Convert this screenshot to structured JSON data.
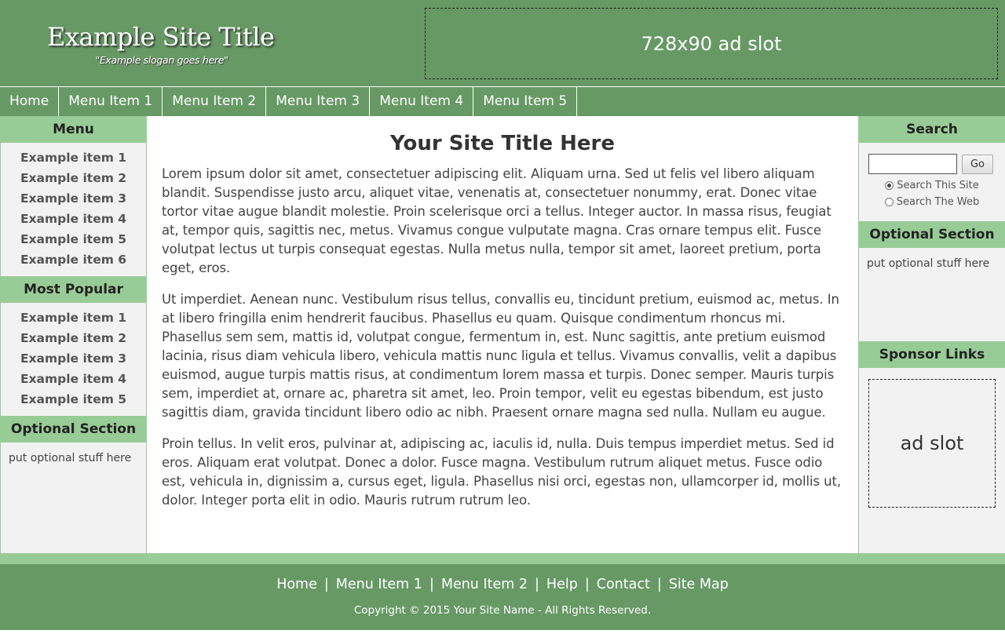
{
  "header": {
    "site_title": "Example Site Title",
    "slogan": "\"Example slogan goes here\"",
    "ad_top": "728x90 ad slot"
  },
  "nav": [
    "Home",
    "Menu Item 1",
    "Menu Item 2",
    "Menu Item 3",
    "Menu Item 4",
    "Menu Item 5"
  ],
  "left": {
    "menu_title": "Menu",
    "menu_items": [
      "Example item 1",
      "Example item 2",
      "Example item 3",
      "Example item 4",
      "Example item 5",
      "Example item 6"
    ],
    "popular_title": "Most Popular",
    "popular_items": [
      "Example item 1",
      "Example item 2",
      "Example item 3",
      "Example item 4",
      "Example item 5"
    ],
    "optional_title": "Optional Section",
    "optional_text": "put optional stuff here"
  },
  "main": {
    "title": "Your Site Title Here",
    "paragraphs": [
      "Lorem ipsum dolor sit amet, consectetuer adipiscing elit. Aliquam urna. Sed ut felis vel libero aliquam blandit. Suspendisse justo arcu, aliquet vitae, venenatis at, consectetuer nonummy, erat. Donec vitae tortor vitae augue blandit molestie. Proin scelerisque orci a tellus. Integer auctor. In massa risus, feugiat at, tempor quis, sagittis nec, metus. Vivamus congue vulputate magna. Cras ornare tempus elit. Fusce volutpat lectus ut turpis consequat egestas. Nulla metus nulla, tempor sit amet, laoreet pretium, porta eget, eros.",
      "Ut imperdiet. Aenean nunc. Vestibulum risus tellus, convallis eu, tincidunt pretium, euismod ac, metus. In at libero fringilla enim hendrerit faucibus. Phasellus eu quam. Quisque condimentum rhoncus mi. Phasellus sem sem, mattis id, volutpat congue, fermentum in, est. Nunc sagittis, ante pretium euismod lacinia, risus diam vehicula libero, vehicula mattis nunc ligula et tellus. Vivamus convallis, velit a dapibus euismod, augue turpis mattis risus, at condimentum lorem massa et turpis. Donec semper. Mauris turpis sem, imperdiet at, ornare ac, pharetra sit amet, leo. Proin tempor, velit eu egestas bibendum, est justo sagittis diam, gravida tincidunt libero odio ac nibh. Praesent ornare magna sed nulla. Nullam eu augue.",
      "Proin tellus. In velit eros, pulvinar at, adipiscing ac, iaculis id, nulla. Duis tempus imperdiet metus. Sed id eros. Aliquam erat volutpat. Donec a dolor. Fusce magna. Vestibulum rutrum aliquet metus. Fusce odio est, vehicula in, dignissim a, cursus eget, ligula. Phasellus nisi orci, egestas non, ullamcorper id, mollis ut, dolor. Integer porta elit in odio. Mauris rutrum rutrum leo."
    ]
  },
  "right": {
    "search_title": "Search",
    "search_input_value": "",
    "go_label": "Go",
    "radio_site": "Search This Site",
    "radio_web": "Search The Web",
    "optional_title": "Optional Section",
    "optional_text": "put optional stuff here",
    "sponsor_title": "Sponsor Links",
    "sponsor_ad": "ad slot"
  },
  "footer": {
    "links": [
      "Home",
      "Menu Item 1",
      "Menu Item 2",
      "Help",
      "Contact",
      "Site Map"
    ],
    "separator": "|",
    "copyright": "Copyright © 2015 Your Site Name - All Rights Reserved."
  },
  "colors": {
    "header_green": "#679965",
    "accent_green": "#98cc96",
    "sidebar_bg": "#f2f2f2"
  }
}
